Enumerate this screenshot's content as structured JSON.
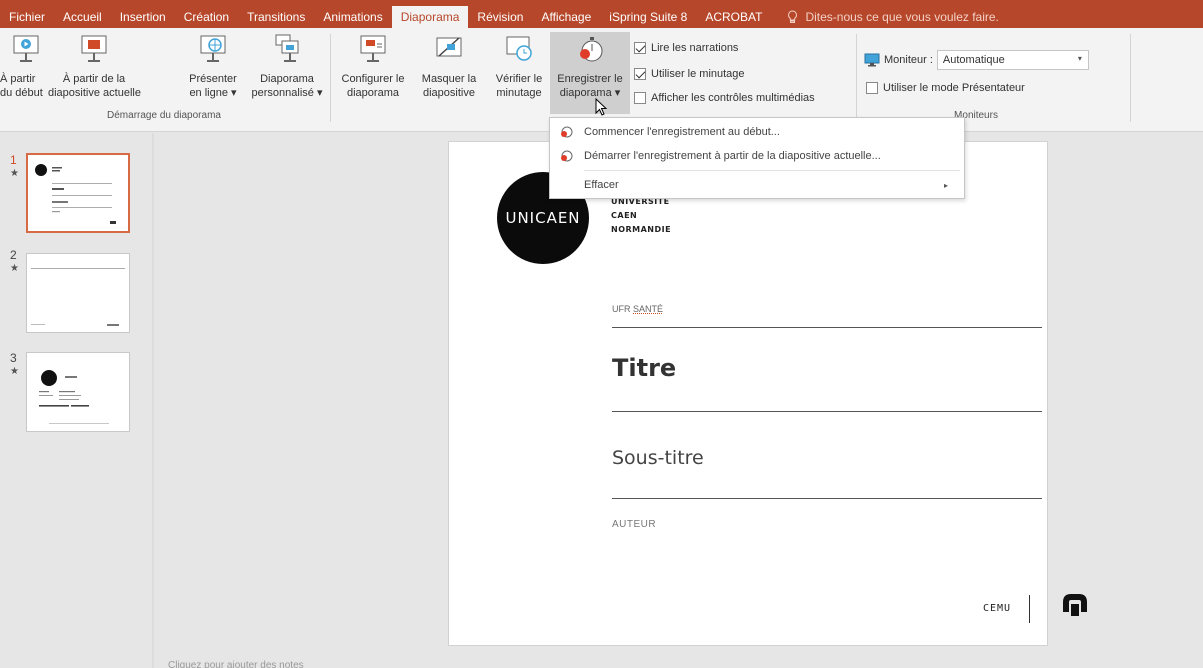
{
  "tabs": [
    {
      "label": "Fichier"
    },
    {
      "label": "Accueil"
    },
    {
      "label": "Insertion"
    },
    {
      "label": "Création"
    },
    {
      "label": "Transitions"
    },
    {
      "label": "Animations"
    },
    {
      "label": "Diaporama",
      "active": true
    },
    {
      "label": "Révision"
    },
    {
      "label": "Affichage"
    },
    {
      "label": "iSpring Suite 8"
    },
    {
      "label": "ACROBAT"
    }
  ],
  "tell_me": "Dites-nous ce que vous voulez faire.",
  "ribbon": {
    "start_from_beginning": "À partir\ndu début",
    "start_from_current": "À partir de la\ndiapositive actuelle",
    "present_online": "Présenter\nen ligne ▾",
    "custom_show": "Diaporama\npersonnalisé ▾",
    "group_start": "Démarrage du diaporama",
    "setup_show": "Configurer le\ndiaporama",
    "hide_slide": "Masquer la\ndiapositive",
    "rehearse": "Vérifier le\nminutage",
    "record": "Enregistrer le\ndiaporama ▾",
    "play_narrations": "Lire les narrations",
    "use_timings": "Utiliser le minutage",
    "show_media_controls": "Afficher les contrôles multimédias",
    "monitor_label": "Moniteur :",
    "monitor_value": "Automatique",
    "presenter_view": "Utiliser le mode Présentateur",
    "group_monitors": "Moniteurs"
  },
  "menu": {
    "item1": "Commencer l'enregistrement au début...",
    "item2": "Démarrer l'enregistrement à partir de la diapositive actuelle...",
    "item3": "Effacer"
  },
  "thumbnails": [
    {
      "num": "1",
      "selected": true
    },
    {
      "num": "2",
      "selected": false
    },
    {
      "num": "3",
      "selected": false
    }
  ],
  "slide": {
    "logo_text": "UNICAEN",
    "univ_line1": "UNIVERSITÉ",
    "univ_line2": "CAEN",
    "univ_line3": "NORMANDIE",
    "ufr_prefix": "UFR ",
    "ufr_word": "SANTÉ",
    "title": "Titre",
    "subtitle": "Sous-titre",
    "author": "AUTEUR",
    "cemu": "CEMU"
  },
  "status": "Cliquez pour ajouter des notes"
}
